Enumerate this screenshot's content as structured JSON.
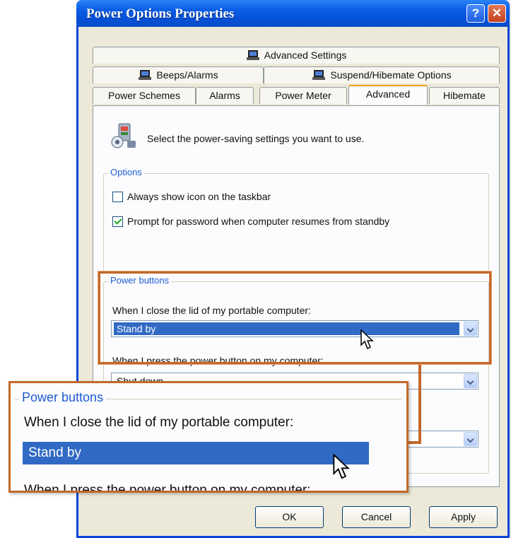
{
  "window": {
    "title": "Power Options Properties",
    "help_glyph": "?",
    "close_glyph": "✕"
  },
  "tabs_row1": [
    {
      "label": "Advanced Settings",
      "icon": "laptop-icon"
    }
  ],
  "tabs_row2": [
    {
      "label": "Beeps/Alarms",
      "icon": "laptop-icon"
    },
    {
      "label": "Suspend/Hibemate Options",
      "icon": "laptop-icon"
    }
  ],
  "tabs_row3": [
    {
      "label": "Power Schemes"
    },
    {
      "label": "Alarms"
    },
    {
      "label": "Power Meter"
    },
    {
      "label": "Advanced",
      "active": true
    },
    {
      "label": "Hibemate"
    }
  ],
  "intro": {
    "text": "Select the power-saving settings you want to use.",
    "icon": "power-settings-icon"
  },
  "options": {
    "legend": "Options",
    "items": [
      {
        "label": "Always show icon on the taskbar",
        "checked": false
      },
      {
        "label": "Prompt for password when computer resumes from standby",
        "checked": true
      }
    ]
  },
  "power_buttons": {
    "legend": "Power buttons",
    "lid_label": "When I close the lid of my portable computer:",
    "lid_value": "Stand by",
    "power_label": "When I press the power button on my computer:",
    "power_value": "Shut down",
    "sleep_value": ""
  },
  "buttons": {
    "ok": "OK",
    "cancel": "Cancel",
    "apply": "Apply"
  },
  "colors": {
    "accent": "#316ac5",
    "highlight": "#c2692a",
    "titlebar": "#0a5fe6"
  }
}
